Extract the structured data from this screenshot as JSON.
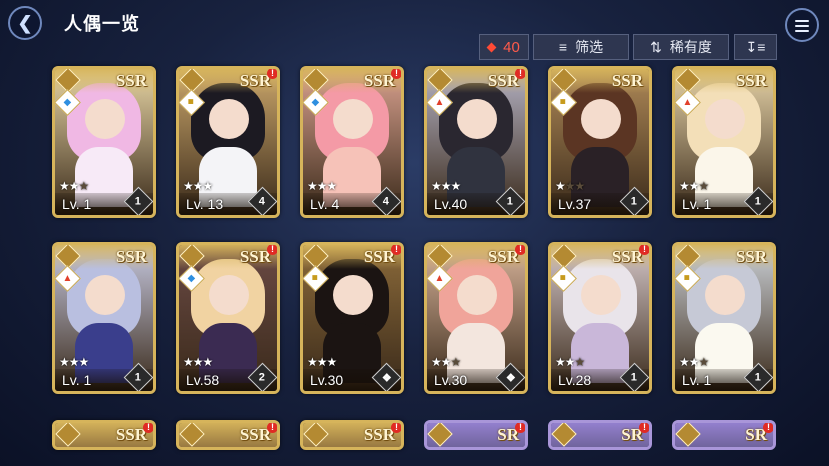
{
  "header": {
    "title": "人偶一览",
    "back_icon": "back-arrow-icon",
    "menu_icon": "hamburger-menu-icon"
  },
  "toolbar": {
    "count": "40",
    "filter_label": "筛选",
    "sort_label": "稀有度",
    "order_icon": "sort-order-icon"
  },
  "colors": {
    "accent_red": "#ff4a35",
    "gold_frame": "#d6b45b",
    "sr_frame": "#a996d9"
  },
  "cards": [
    {
      "rarity": "SSR",
      "level": "Lv. 1",
      "stars": 2,
      "element": "water",
      "awaken": "1",
      "new": false,
      "hair": "#f0b8e4",
      "body": "#f7eaf7",
      "bg": "#e8d6a6"
    },
    {
      "rarity": "SSR",
      "level": "Lv. 13",
      "stars": 3,
      "element": "earth",
      "awaken": "4",
      "new": true,
      "hair": "#1c1a22",
      "body": "#f4f4f7",
      "bg": "#caa66b"
    },
    {
      "rarity": "SSR",
      "level": "Lv. 4",
      "stars": 3,
      "element": "water",
      "awaken": "4",
      "new": true,
      "hair": "#f49aa6",
      "body": "#f6c2b8",
      "bg": "#d9a18f"
    },
    {
      "rarity": "SSR",
      "level": "Lv.40",
      "stars": 3,
      "element": "fire",
      "awaken": "1",
      "new": true,
      "hair": "#2a2730",
      "body": "#30333f",
      "bg": "#b4b2c4"
    },
    {
      "rarity": "SSR",
      "level": "Lv.37",
      "stars": 1,
      "element": "earth",
      "awaken": "1",
      "new": false,
      "hair": "#5b3523",
      "body": "#2a2126",
      "bg": "#b08a58"
    },
    {
      "rarity": "SSR",
      "level": "Lv. 1",
      "stars": 2,
      "element": "fire",
      "awaken": "1",
      "new": false,
      "hair": "#f3dfb8",
      "body": "#fbf6ea",
      "bg": "#e7d4a9"
    },
    {
      "rarity": "SSR",
      "level": "Lv. 1",
      "stars": 3,
      "element": "fire",
      "awaken": "1",
      "new": false,
      "hair": "#b9bfe0",
      "body": "#3a3e8c",
      "bg": "#c7c9e0"
    },
    {
      "rarity": "SSR",
      "level": "Lv.58",
      "stars": 3,
      "element": "water",
      "awaken": "2",
      "new": true,
      "hair": "#f1d3a2",
      "body": "#3b2b52",
      "bg": "#6b4a45"
    },
    {
      "rarity": "SSR",
      "level": "Lv.30",
      "stars": 3,
      "element": "earth",
      "awaken": "W",
      "new": true,
      "hair": "#1b1412",
      "body": "#1b1412",
      "bg": "#8b6a3a"
    },
    {
      "rarity": "SSR",
      "level": "Lv.30",
      "stars": 2,
      "element": "fire",
      "awaken": "W",
      "new": true,
      "hair": "#f0a49a",
      "body": "#f3e6de",
      "bg": "#d7b39a"
    },
    {
      "rarity": "SSR",
      "level": "Lv.28",
      "stars": 2,
      "element": "earth",
      "awaken": "1",
      "new": true,
      "hair": "#e9e4ea",
      "body": "#c9b7d9",
      "bg": "#d5c7c9"
    },
    {
      "rarity": "SSR",
      "level": "Lv. 1",
      "stars": 2,
      "element": "earth",
      "awaken": "1",
      "new": false,
      "hair": "#c6c9d6",
      "body": "#fbf9f0",
      "bg": "#cdd2d8"
    }
  ],
  "partial_cards": [
    {
      "rarity": "SSR",
      "new": true,
      "frame": "gold"
    },
    {
      "rarity": "SSR",
      "new": true,
      "frame": "gold"
    },
    {
      "rarity": "SSR",
      "new": true,
      "frame": "gold"
    },
    {
      "rarity": "SR",
      "new": true,
      "frame": "sr"
    },
    {
      "rarity": "SR",
      "new": true,
      "frame": "sr"
    },
    {
      "rarity": "SR",
      "new": true,
      "frame": "sr"
    }
  ]
}
